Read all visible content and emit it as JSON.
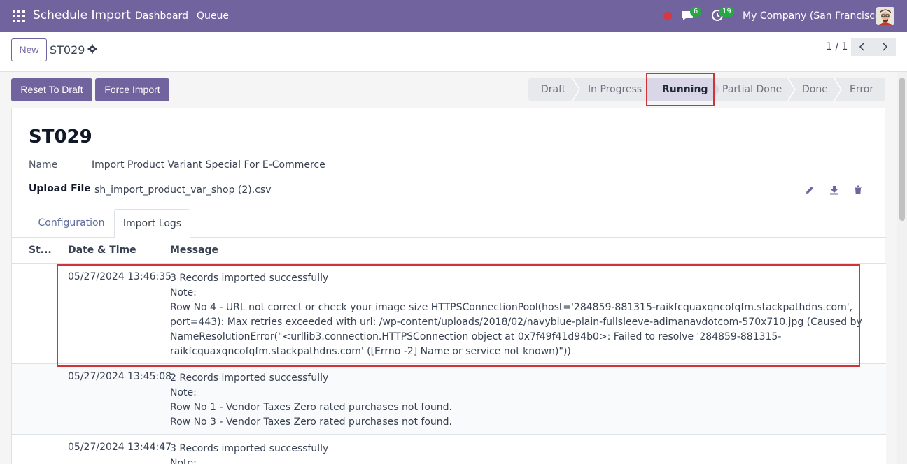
{
  "navbar": {
    "app_title": "Schedule Import",
    "menu": [
      "Dashboard",
      "Queue"
    ],
    "messages_count": "6",
    "activities_count": "19",
    "company": "My Company (San Francisco)"
  },
  "control": {
    "new_label": "New",
    "record_name": "ST029",
    "pager": "1 / 1"
  },
  "actions": {
    "reset_label": "Reset To Draft",
    "force_label": "Force Import"
  },
  "statusbar": {
    "stages": [
      "Draft",
      "In Progress",
      "Running",
      "Partial Done",
      "Done",
      "Error"
    ],
    "active": "Running"
  },
  "form": {
    "title": "ST029",
    "name_label": "Name",
    "name_value": "Import Product Variant Special For E-Commerce",
    "upload_label": "Upload File",
    "upload_value": "sh_import_product_var_shop (2).csv"
  },
  "tabs": [
    "Configuration",
    "Import Logs"
  ],
  "log_table": {
    "headers": [
      "St...",
      "Date & Time",
      "Message"
    ],
    "rows": [
      {
        "date": "05/27/2024 13:46:35",
        "lines": [
          "3 Records imported successfully",
          "Note:",
          "Row No 4  - URL not correct or check your image size HTTPSConnectionPool(host='284859-881315-raikfcquaxqncofqfm.stackpathdns.com', port=443): Max retries exceeded with url: /wp-content/uploads/2018/02/navyblue-plain-fullsleeve-adimanavdotcom-570x710.jpg (Caused by NameResolutionError(\"<urllib3.connection.HTTPSConnection object at 0x7f49f41d94b0>: Failed to resolve '284859-881315-raikfcquaxqncofqfm.stackpathdns.com' ([Errno -2] Name or service not known)\"))"
        ]
      },
      {
        "date": "05/27/2024 13:45:08",
        "lines": [
          "2 Records imported successfully",
          "Note:",
          "Row No 1  - Vendor Taxes Zero rated purchases not found.",
          "Row No 3  - Vendor Taxes Zero rated purchases not found."
        ]
      },
      {
        "date": "05/27/2024 13:44:47",
        "lines": [
          "3 Records imported successfully",
          "Note:"
        ]
      }
    ]
  },
  "colors": {
    "brand": "#71639e",
    "highlight": "#d13438",
    "badge": "#28a745"
  }
}
